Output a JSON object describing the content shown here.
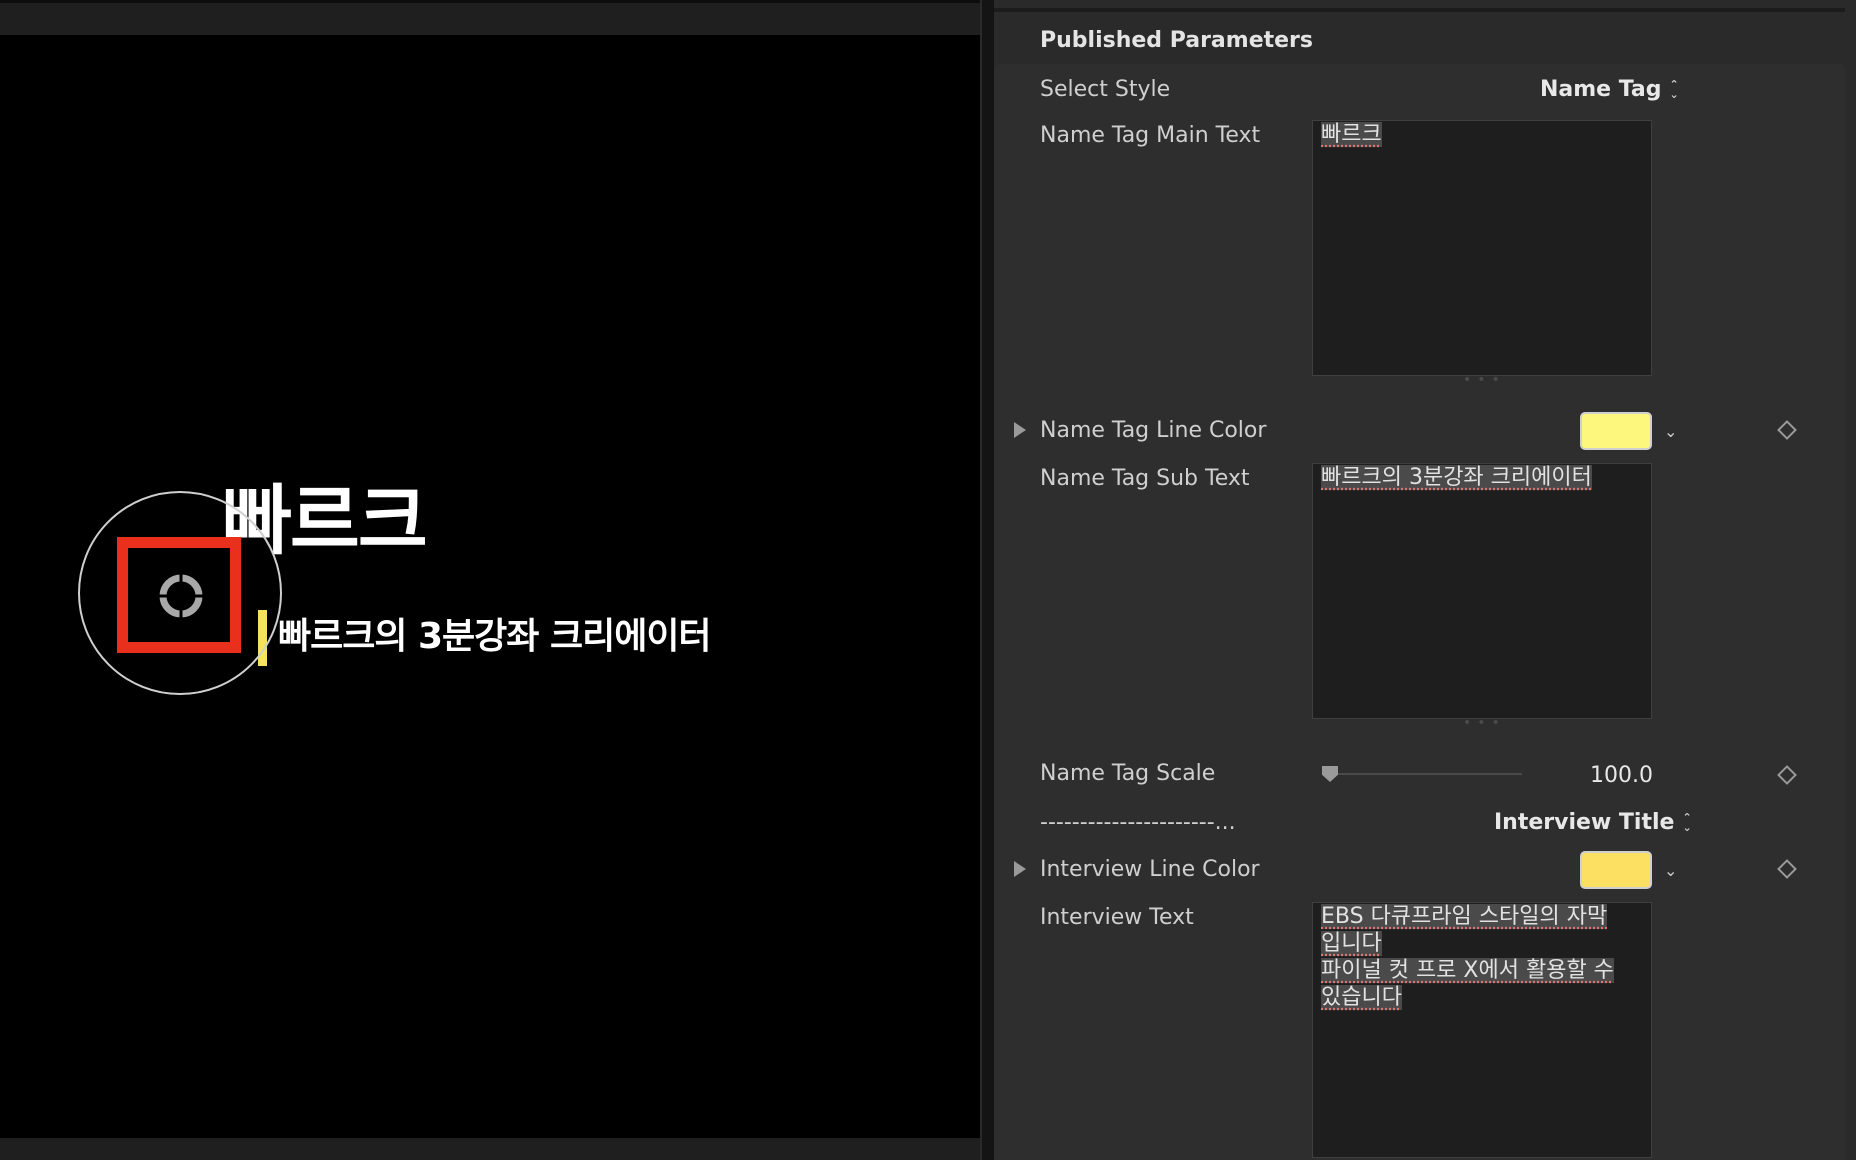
{
  "viewer": {
    "main_text": "빠르크",
    "sub_text": "빠르크의 3분강좌 크리에이터",
    "accent_color": "#f6e35d",
    "highlight_color": "#e8301c"
  },
  "inspector": {
    "section_title": "Published Parameters",
    "select_style": {
      "label": "Select Style",
      "value": "Name Tag"
    },
    "name_tag_main_text": {
      "label": "Name Tag Main Text",
      "value": "빠르크"
    },
    "name_tag_line_color": {
      "label": "Name Tag Line Color",
      "color": "#fdf77e"
    },
    "name_tag_sub_text": {
      "label": "Name Tag Sub Text",
      "value": "빠르크의 3분강좌 크리에이터"
    },
    "name_tag_scale": {
      "label": "Name Tag Scale",
      "value": "100.0",
      "fraction": 0.0
    },
    "separator": {
      "label": "----------------------...",
      "value": "Interview Title"
    },
    "interview_line_color": {
      "label": "Interview Line Color",
      "color": "#fbe062"
    },
    "interview_text": {
      "label": "Interview Text",
      "line1": "EBS 다큐프라임 스타일의 자막",
      "line2": "입니다",
      "line3": "파이널 컷 프로 X에서 활용할 수",
      "line4": "있습니다"
    }
  },
  "icons": {
    "disclosure": "disclosure-triangle-icon",
    "keyframe": "keyframe-diamond-icon",
    "popup": "up-down-chevron-icon",
    "swatch_menu": "chevron-down-icon",
    "anchor": "anchor-point-icon"
  }
}
